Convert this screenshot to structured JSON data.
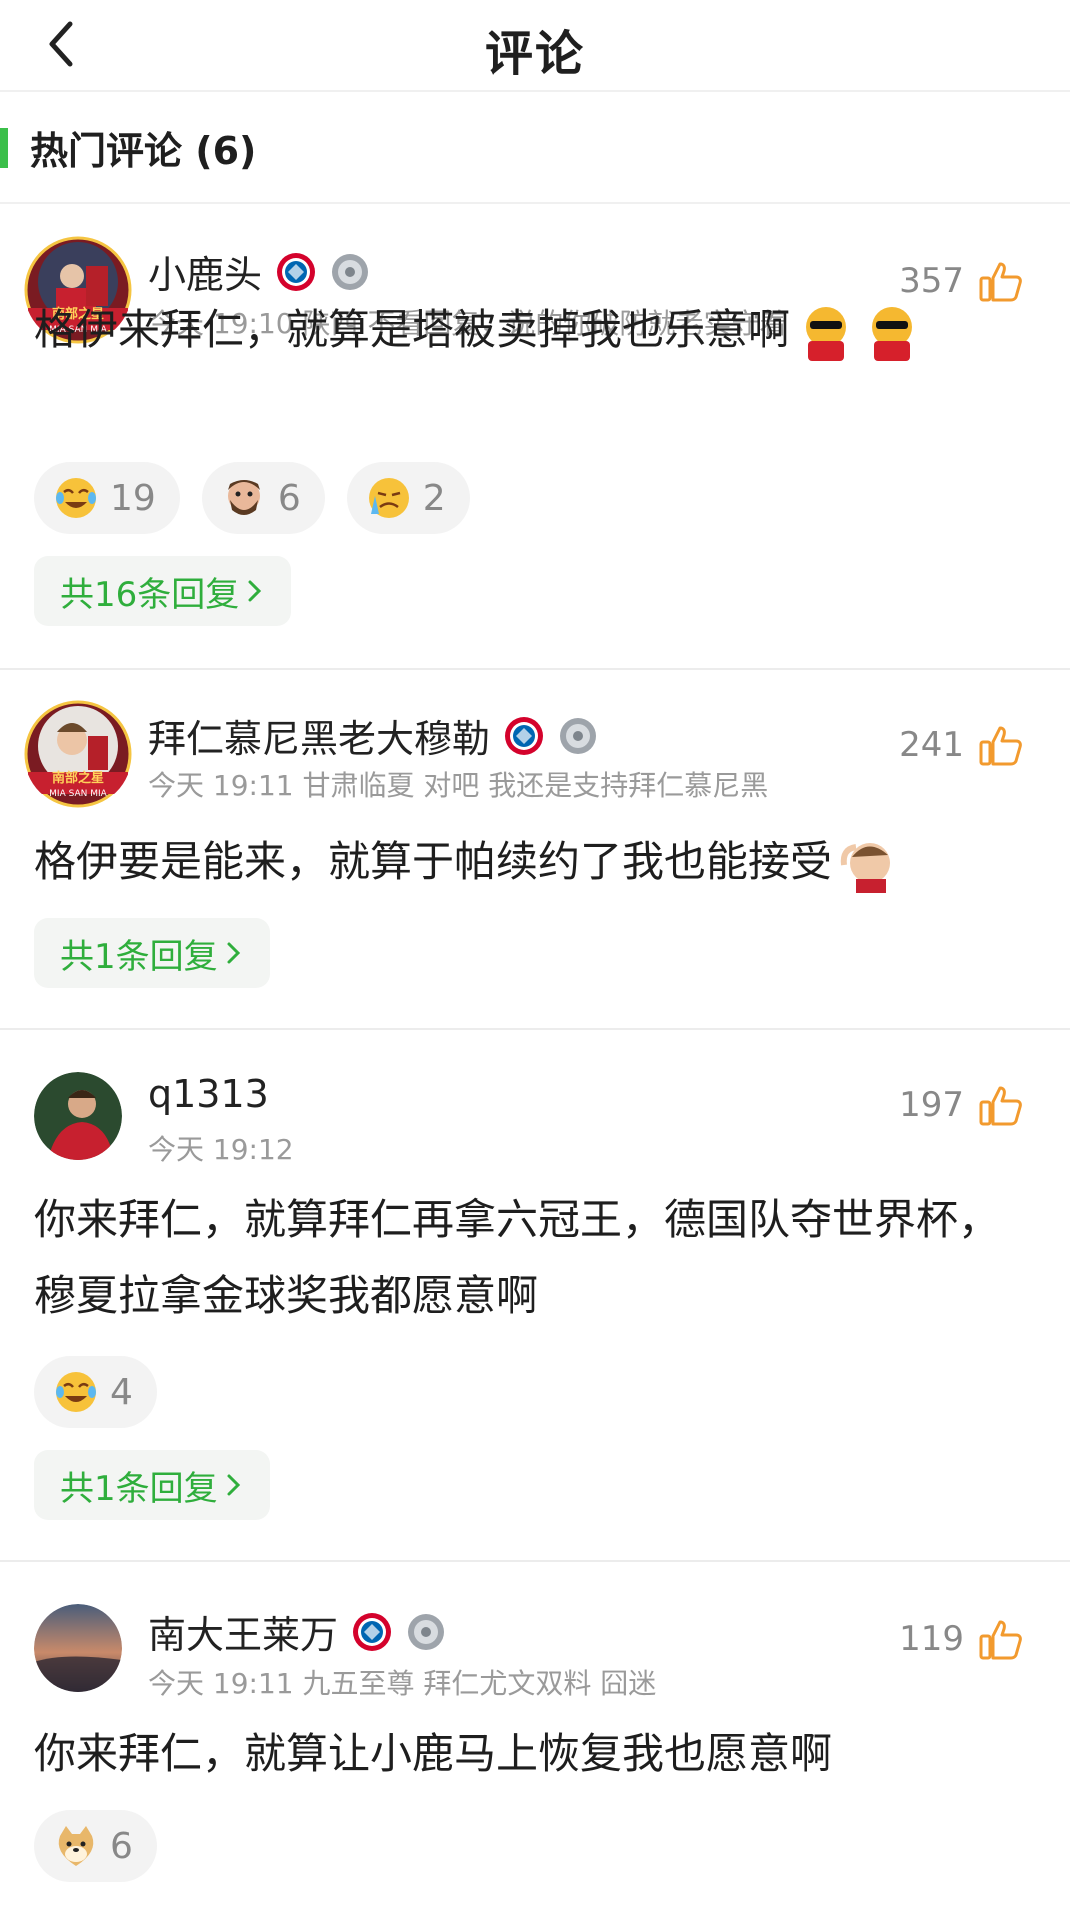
{
  "header": {
    "title": "评论"
  },
  "section": {
    "title": "热门评论 (6)"
  },
  "comments": [
    {
      "username": "小鹿头",
      "meta": "今天 19:10 陕西  不看回复，说的你破防就老实守着",
      "likes": "357",
      "text": "格伊来拜仁，就算是塔被卖掉我也乐意啊",
      "reactions": [
        {
          "icon": "laugh-cry-emoji-icon",
          "count": "19"
        },
        {
          "icon": "bearded-face-sticker-icon",
          "count": "6"
        },
        {
          "icon": "crying-emoji-icon",
          "count": "2"
        }
      ],
      "replies": "共16条回复"
    },
    {
      "username": "拜仁慕尼黑老大穆勒",
      "meta": "今天 19:11 甘肃临夏  对吧 我还是支持拜仁慕尼黑",
      "likes": "241",
      "text": "格伊要是能来，就算于帕续约了我也能接受",
      "replies": "共1条回复"
    },
    {
      "username": "q1313",
      "meta": "今天 19:12",
      "likes": "197",
      "text": "你来拜仁，就算拜仁再拿六冠王，德国队夺世界杯，穆夏拉拿金球奖我都愿意啊",
      "reactions": [
        {
          "icon": "laugh-cry-emoji-icon",
          "count": "4"
        }
      ],
      "replies": "共1条回复"
    },
    {
      "username": "南大王莱万",
      "meta": "今天 19:11 九五至尊 拜仁尤文双料 囧迷",
      "likes": "119",
      "text": "你来拜仁，就算让小鹿马上恢复我也愿意啊",
      "reactions": [
        {
          "icon": "doge-emoji-icon",
          "count": "6"
        }
      ]
    }
  ],
  "avatar_badge_text": {
    "line1": "南部之星",
    "line2": "MIA SAN MIA"
  },
  "colors": {
    "accent_green": "#3bbf4a",
    "link_green": "#2fae3c",
    "like_orange": "#f29a2e"
  }
}
